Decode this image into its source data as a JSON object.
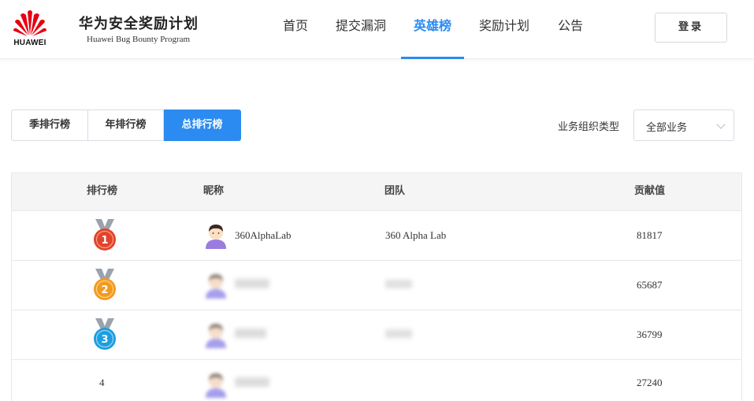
{
  "header": {
    "logo_text": "HUAWEI",
    "brand_title": "华为安全奖励计划",
    "brand_subtitle": "Huawei Bug Bounty Program",
    "nav": [
      "首页",
      "提交漏洞",
      "英雄榜",
      "奖励计划",
      "公告"
    ],
    "active_nav": "英雄榜",
    "login_label": "登录"
  },
  "tabs": {
    "items": [
      "季排行榜",
      "年排行榜",
      "总排行榜"
    ],
    "active": "总排行榜"
  },
  "filter": {
    "label": "业务组织类型",
    "value": "全部业务",
    "icon": "chevron-down-icon"
  },
  "table": {
    "columns": {
      "rank": "排行榜",
      "nickname": "昵称",
      "team": "团队",
      "contribution": "贡献值"
    },
    "rows": [
      {
        "rank": "1",
        "medal": "red",
        "nickname": "360AlphaLab",
        "team": "360 Alpha Lab",
        "contribution": "81817",
        "obscured": false
      },
      {
        "rank": "2",
        "medal": "orange",
        "nickname": "",
        "team": "",
        "contribution": "65687",
        "obscured": true
      },
      {
        "rank": "3",
        "medal": "blue",
        "nickname": "",
        "team": "",
        "contribution": "36799",
        "obscured": true
      },
      {
        "rank": "4",
        "medal": "",
        "nickname": "",
        "team": "",
        "contribution": "27240",
        "obscured": true
      }
    ]
  },
  "colors": {
    "accent": "#2b8bf0",
    "brand_red": "#e60012",
    "medal_red": "#e2442a",
    "medal_orange": "#f39a1e",
    "medal_blue": "#1e9de0"
  }
}
